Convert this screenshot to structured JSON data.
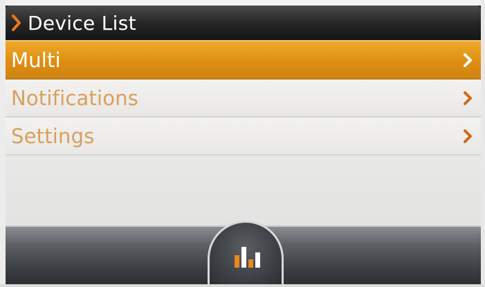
{
  "header": {
    "title": "Device List",
    "icon": "chevron-right-icon"
  },
  "menu": {
    "items": [
      {
        "label": "Multi",
        "selected": true,
        "icon": "chevron-right-icon"
      },
      {
        "label": "Notifications",
        "selected": false,
        "icon": "chevron-right-icon"
      },
      {
        "label": "Settings",
        "selected": false,
        "icon": "chevron-right-icon"
      }
    ]
  },
  "bottom_bar": {
    "home_icon": "bar-chart-icon"
  },
  "colors": {
    "accent": "#e5961c",
    "title_chevron": "#e9781e",
    "item_text": "#d9a05c",
    "selected_text": "#ffffff",
    "chevron_inactive": "#d06a1a"
  }
}
